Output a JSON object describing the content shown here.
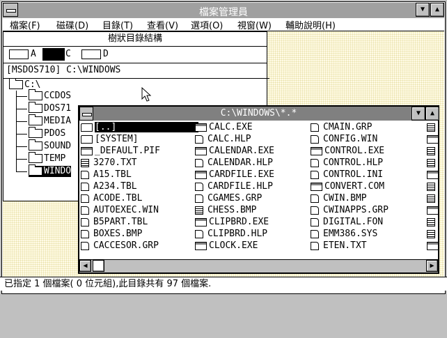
{
  "window": {
    "title": "檔案管理員"
  },
  "menu": [
    "檔案(F)",
    "磁碟(D)",
    "目錄(T)",
    "查看(V)",
    "選項(O)",
    "視窗(W)",
    "輔助說明(H)"
  ],
  "tree": {
    "title": "樹狀目錄結構",
    "drives": [
      {
        "letter": "A"
      },
      {
        "letter": "C",
        "selected": true
      },
      {
        "letter": "D"
      }
    ],
    "path": "[MSDOS710]  C:\\WINDOWS",
    "root": "C:\\",
    "items": [
      "CCDOS",
      "DOS71",
      "MEDIA",
      "PDOS",
      "SOUND",
      "TEMP",
      "WINDO"
    ]
  },
  "dir": {
    "title": "C:\\WINDOWS\\*.*",
    "col1": [
      {
        "name": "[..]",
        "icon": "up-folder",
        "sel": true
      },
      {
        "name": "[SYSTEM]",
        "icon": "folder"
      },
      {
        "name": "_DEFAULT.PIF",
        "icon": "app"
      },
      {
        "name": "3270.TXT",
        "icon": "txt"
      },
      {
        "name": "A15.TBL",
        "icon": "doc"
      },
      {
        "name": "A234.TBL",
        "icon": "doc"
      },
      {
        "name": "ACODE.TBL",
        "icon": "doc"
      },
      {
        "name": "AUTOEXEC.WIN",
        "icon": "doc"
      },
      {
        "name": "B5PART.TBL",
        "icon": "doc"
      },
      {
        "name": "BOXES.BMP",
        "icon": "doc"
      },
      {
        "name": "CACCESOR.GRP",
        "icon": "doc"
      }
    ],
    "col2": [
      {
        "name": "CALC.EXE",
        "icon": "app"
      },
      {
        "name": "CALC.HLP",
        "icon": "doc"
      },
      {
        "name": "CALENDAR.EXE",
        "icon": "app"
      },
      {
        "name": "CALENDAR.HLP",
        "icon": "doc"
      },
      {
        "name": "CARDFILE.EXE",
        "icon": "app"
      },
      {
        "name": "CARDFILE.HLP",
        "icon": "doc"
      },
      {
        "name": "CGAMES.GRP",
        "icon": "doc"
      },
      {
        "name": "CHESS.BMP",
        "icon": "txt"
      },
      {
        "name": "CLIPBRD.EXE",
        "icon": "app"
      },
      {
        "name": "CLIPBRD.HLP",
        "icon": "doc"
      },
      {
        "name": "CLOCK.EXE",
        "icon": "app"
      }
    ],
    "col3": [
      {
        "name": "CMAIN.GRP",
        "icon": "doc"
      },
      {
        "name": "CONFIG.WIN",
        "icon": "doc"
      },
      {
        "name": "CONTROL.EXE",
        "icon": "app"
      },
      {
        "name": "CONTROL.HLP",
        "icon": "doc"
      },
      {
        "name": "CONTROL.INI",
        "icon": "doc"
      },
      {
        "name": "CONVERT.COM",
        "icon": "app"
      },
      {
        "name": "CWIN.BMP",
        "icon": "doc"
      },
      {
        "name": "CWINAPPS.GRP",
        "icon": "doc"
      },
      {
        "name": "DIGITAL.FON",
        "icon": "doc"
      },
      {
        "name": "EMM386.SYS",
        "icon": "doc"
      },
      {
        "name": "ETEN.TXT",
        "icon": "doc"
      }
    ]
  },
  "status": "已指定 1 個檔案( 0 位元組),此目錄共有 97 個檔案."
}
